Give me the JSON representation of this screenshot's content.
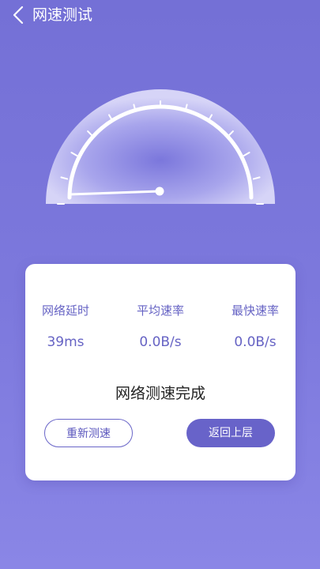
{
  "header": {
    "back_icon": "chevron-left-icon",
    "title": "网速测试"
  },
  "gauge": {
    "needle_value": 0,
    "accent": "#ffffff"
  },
  "stats": [
    {
      "label": "网络延时",
      "value": "39ms"
    },
    {
      "label": "平均速率",
      "value": "0.0B/s"
    },
    {
      "label": "最快速率",
      "value": "0.0B/s"
    }
  ],
  "status_text": "网络测速完成",
  "buttons": {
    "retest_label": "重新测速",
    "back_label": "返回上层"
  },
  "colors": {
    "background": "#7470d6",
    "accent": "#6863c9",
    "card": "#ffffff"
  }
}
